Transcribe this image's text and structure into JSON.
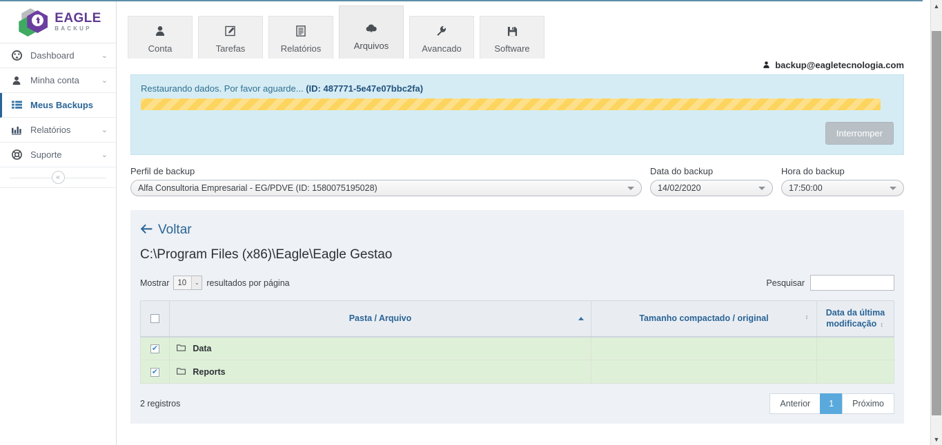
{
  "brand": {
    "name": "EAGLE",
    "sub": "BACKUP",
    "purple": "#5e3a91",
    "green": "#3faa62"
  },
  "sidebar": {
    "items": [
      {
        "label": "Dashboard",
        "icon": "dashboard-icon",
        "glyph": "◔",
        "chevron": "⌄",
        "active": false
      },
      {
        "label": "Minha conta",
        "icon": "user-icon",
        "glyph": "●",
        "chevron": "⌄",
        "active": false
      },
      {
        "label": "Meus Backups",
        "icon": "list-icon",
        "glyph": "≡",
        "chevron": "",
        "active": true
      },
      {
        "label": "Relatórios",
        "icon": "bar-chart-icon",
        "glyph": "▥",
        "chevron": "⌄",
        "active": false
      },
      {
        "label": "Suporte",
        "icon": "life-ring-icon",
        "glyph": "⊕",
        "chevron": "⌄",
        "active": false
      }
    ],
    "collapse_glyph": "«"
  },
  "tabs": [
    {
      "label": "Conta",
      "icon": "person-icon",
      "active": false
    },
    {
      "label": "Tarefas",
      "icon": "edit-square-icon",
      "active": false
    },
    {
      "label": "Relatórios",
      "icon": "document-list-icon",
      "active": false
    },
    {
      "label": "Arquivos",
      "icon": "cloud-download-icon",
      "active": true
    },
    {
      "label": "Avancado",
      "icon": "wrench-icon",
      "active": false
    },
    {
      "label": "Software",
      "icon": "floppy-save-icon",
      "active": false
    }
  ],
  "user": {
    "icon": "user-icon",
    "email": "backup@eagletecnologia.com"
  },
  "alert": {
    "message": "Restaurando dados. Por favor aguarde...",
    "id_label": "(ID: 487771-5e47e07bbc2fa)",
    "progress_style": "striped-indeterminate",
    "progress_color": "#fcd45e",
    "background": "#d5ecf5",
    "stop_button": "Interromper"
  },
  "form": {
    "profile": {
      "label": "Perfil de backup",
      "value": "Alfa Consultoria Empresarial - EG/PDVE (ID: 1580075195028)"
    },
    "date": {
      "label": "Data do backup",
      "value": "14/02/2020"
    },
    "time": {
      "label": "Hora do backup",
      "value": "17:50:00"
    }
  },
  "panel": {
    "back_label": "Voltar",
    "back_icon": "arrow-left-icon",
    "path": "C:\\Program Files (x86)\\Eagle\\Eagle Gestao",
    "show_prefix": "Mostrar",
    "show_value": "10",
    "show_suffix": "resultados por página",
    "search_label": "Pesquisar",
    "search_value": "",
    "search_placeholder": ""
  },
  "table": {
    "columns": [
      {
        "key": "check",
        "label": ""
      },
      {
        "key": "name",
        "label": "Pasta / Arquivo",
        "sort": "asc"
      },
      {
        "key": "size",
        "label": "Tamanho compactado / original",
        "sort": "both"
      },
      {
        "key": "date",
        "label": "Data da última modificação",
        "sort": "both"
      }
    ],
    "rows": [
      {
        "checked": true,
        "icon": "folder-icon",
        "name": "Data",
        "size": "",
        "date": ""
      },
      {
        "checked": true,
        "icon": "folder-icon",
        "name": "Reports",
        "size": "",
        "date": ""
      }
    ],
    "header_checked": false,
    "row_highlight": "#dff0d8"
  },
  "footer": {
    "records": "2 registros",
    "prev": "Anterior",
    "page": "1",
    "next": "Próximo"
  },
  "icons": {
    "sort_both": "↕",
    "caret_down": "▼",
    "chevron_up": "˄",
    "chevron_down": "˅",
    "back_arrow": "←",
    "folder": "☐",
    "user_small": "☗"
  }
}
